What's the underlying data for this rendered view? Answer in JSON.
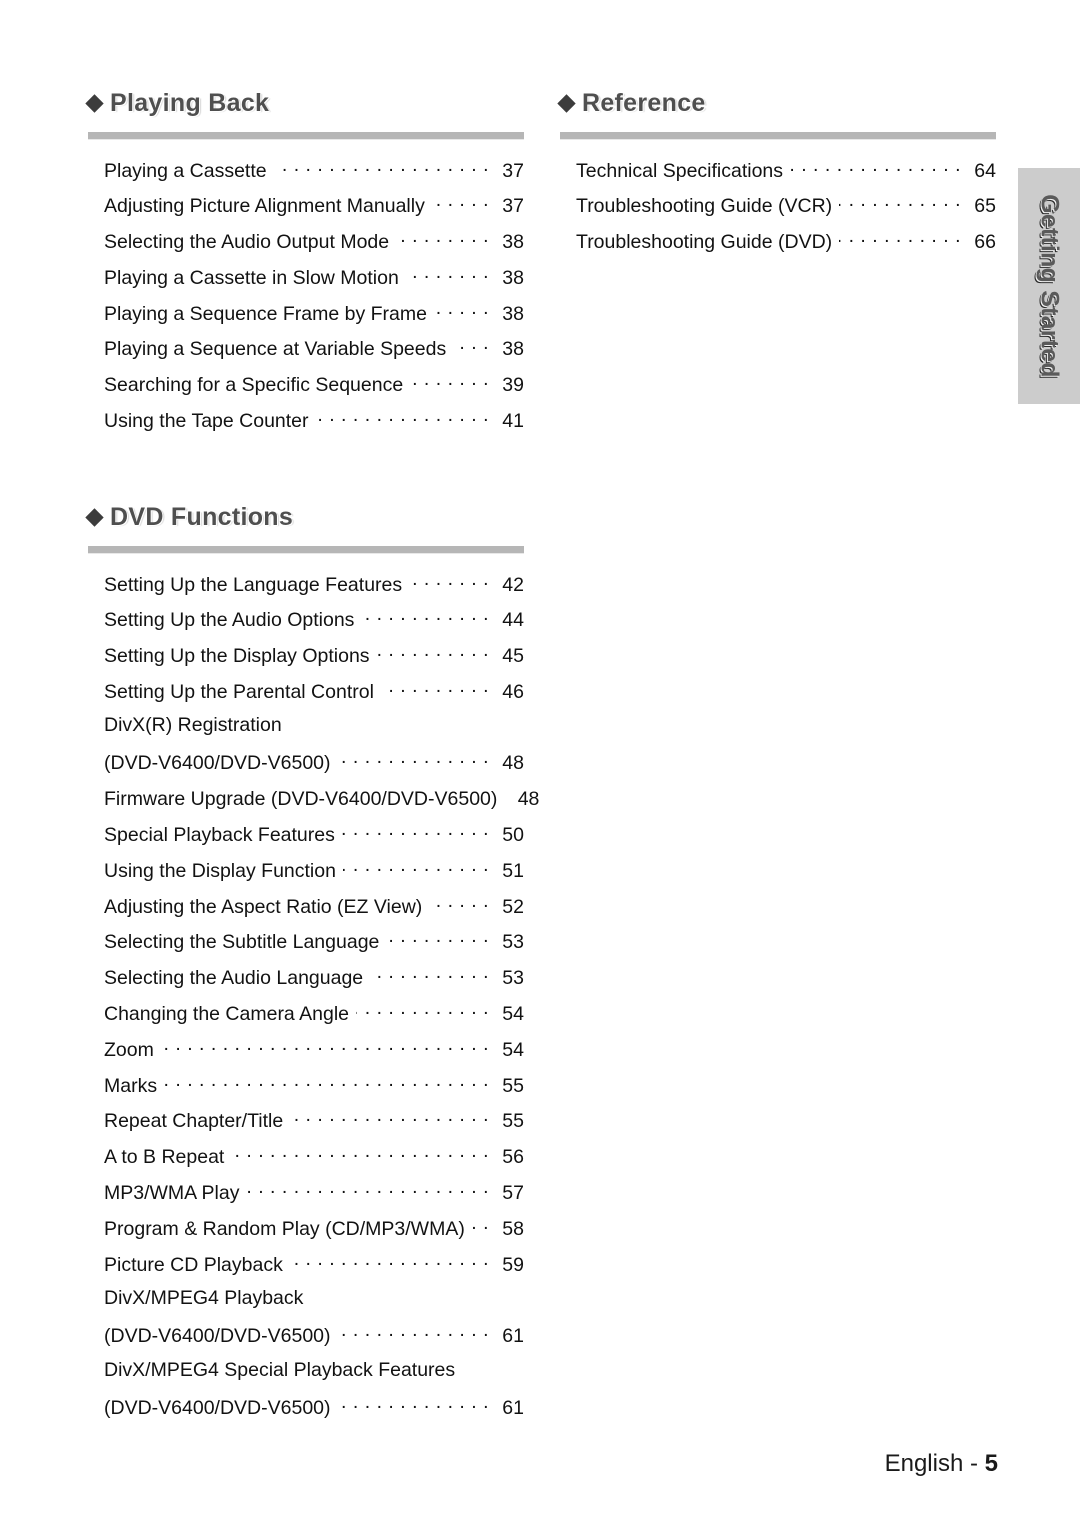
{
  "page": {
    "footer_label": "English -",
    "footer_page": "5",
    "side_tab_label": "Getting Started",
    "accent_rule_color": "#b6b6b6",
    "heading_color": "#4f4f4f",
    "side_tab_bg": "#cccccc"
  },
  "sections": [
    {
      "id": "playing-back",
      "title": "Playing Back",
      "bullet": "diamond-icon",
      "entries": [
        {
          "label": "Playing a Cassette",
          "page": "37"
        },
        {
          "label": "Adjusting Picture Alignment Manually",
          "page": "37"
        },
        {
          "label": "Selecting the Audio Output Mode",
          "page": "38"
        },
        {
          "label": "Playing a Cassette in Slow Motion",
          "page": "38"
        },
        {
          "label": "Playing a Sequence Frame by Frame",
          "page": "38"
        },
        {
          "label": "Playing a Sequence at Variable Speeds",
          "page": "38"
        },
        {
          "label": "Searching for a Specific Sequence",
          "page": "39"
        },
        {
          "label": "Using the Tape Counter",
          "page": "41"
        }
      ]
    },
    {
      "id": "dvd-functions",
      "title": "DVD Functions",
      "bullet": "diamond-icon",
      "entries": [
        {
          "label": "Setting Up the Language Features",
          "page": "42"
        },
        {
          "label": "Setting Up the Audio Options",
          "page": "44"
        },
        {
          "label": "Setting Up the Display Options",
          "page": "45"
        },
        {
          "label": "Setting Up the Parental Control",
          "page": "46"
        },
        {
          "label": "DivX(R) Registration",
          "page": "",
          "wrap": true
        },
        {
          "label": "(DVD-V6400/DVD-V6500)",
          "page": "48"
        },
        {
          "label": "Firmware Upgrade (DVD-V6400/DVD-V6500)",
          "page": "48"
        },
        {
          "label": "Special Playback Features",
          "page": "50"
        },
        {
          "label": "Using the Display Function",
          "page": "51"
        },
        {
          "label": "Adjusting the Aspect Ratio (EZ View)",
          "page": "52"
        },
        {
          "label": "Selecting the Subtitle Language",
          "page": "53"
        },
        {
          "label": "Selecting the Audio Language",
          "page": "53"
        },
        {
          "label": "Changing the Camera Angle",
          "page": "54"
        },
        {
          "label": "Zoom",
          "page": "54"
        },
        {
          "label": "Marks",
          "page": "55"
        },
        {
          "label": "Repeat Chapter/Title",
          "page": "55"
        },
        {
          "label": "A to B Repeat",
          "page": "56"
        },
        {
          "label": "MP3/WMA Play",
          "page": "57"
        },
        {
          "label": "Program & Random Play (CD/MP3/WMA)",
          "page": "58"
        },
        {
          "label": "Picture CD Playback",
          "page": "59"
        },
        {
          "label": "DivX/MPEG4 Playback",
          "page": "",
          "wrap": true
        },
        {
          "label": "(DVD-V6400/DVD-V6500)",
          "page": "61"
        },
        {
          "label": "DivX/MPEG4 Special Playback Features",
          "page": "",
          "wrap": true
        },
        {
          "label": "(DVD-V6400/DVD-V6500)",
          "page": "61"
        }
      ]
    },
    {
      "id": "reference",
      "title": "Reference",
      "bullet": "diamond-icon",
      "entries": [
        {
          "label": "Technical Specifications",
          "page": "64"
        },
        {
          "label": "Troubleshooting Guide (VCR)",
          "page": "65"
        },
        {
          "label": "Troubleshooting Guide (DVD)",
          "page": "66"
        }
      ]
    }
  ]
}
